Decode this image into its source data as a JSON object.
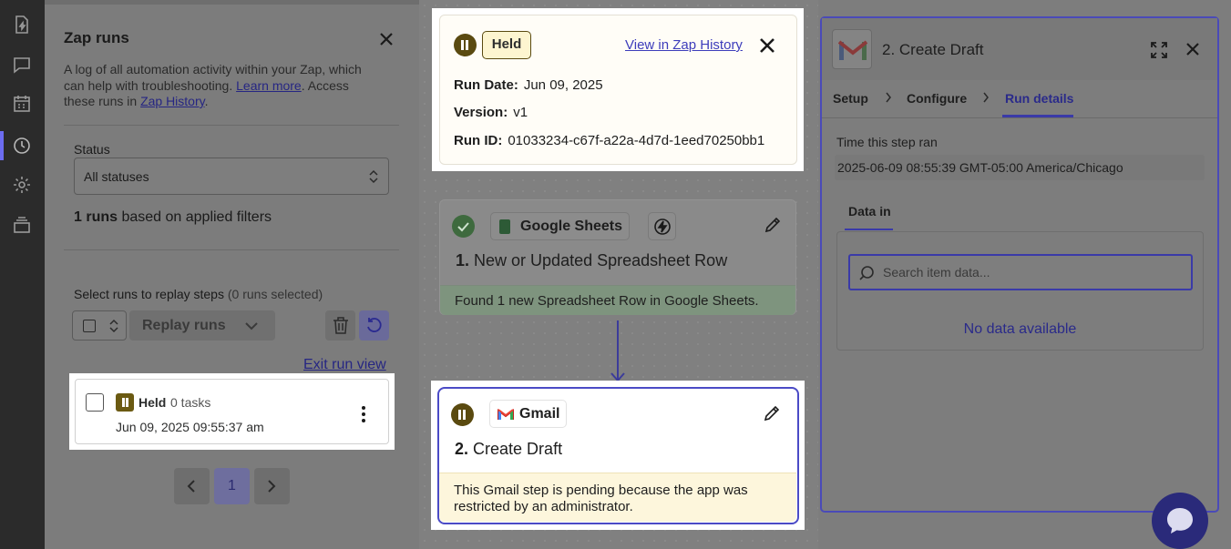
{
  "rail": {
    "icons": [
      "zap-file-icon",
      "comment-icon",
      "calendar-icon",
      "history-icon",
      "settings-icon",
      "versions-icon"
    ]
  },
  "runs_panel": {
    "title": "Zap runs",
    "description_prefix": "A log of all automation activity within your Zap, which can help with troubleshooting. ",
    "learn_more": "Learn more",
    "description_mid": ". Access these runs in ",
    "zap_history_link": "Zap History",
    "description_suffix": ".",
    "status_label": "Status",
    "status_value": "All statuses",
    "count_bold": "1 runs",
    "count_rest": " based on applied filters",
    "select_label": "Select runs to replay steps",
    "selected_count": "(0 runs selected)",
    "replay_label": "Replay runs",
    "exit_link": "Exit run view",
    "run": {
      "status": "Held",
      "tasks": "0 tasks",
      "date": "Jun 09, 2025 09:55:37 am"
    },
    "page": "1"
  },
  "info_card": {
    "badge": "Held",
    "history_link": "View in Zap History",
    "run_date_label": "Run Date:",
    "run_date": "Jun 09, 2025",
    "version_label": "Version:",
    "version": "v1",
    "run_id_label": "Run ID:",
    "run_id": "01033234-c67f-a22a-4d7d-1eed70250bb1"
  },
  "step1": {
    "app": "Google Sheets",
    "number": "1.",
    "title": "New or Updated Spreadsheet Row",
    "message": "Found 1 new Spreadsheet Row in Google Sheets."
  },
  "step2": {
    "app": "Gmail",
    "number": "2.",
    "title": "Create Draft",
    "message": "This Gmail step is pending because the app was restricted by an administrator."
  },
  "detail": {
    "title": "2. Create Draft",
    "tabs": [
      "Setup",
      "Configure",
      "Run details"
    ],
    "time_label": "Time this step ran",
    "time_value": "2025-06-09 08:55:39 GMT-05:00 America/Chicago",
    "data_tab": "Data in",
    "search_placeholder": "Search item data...",
    "no_data": "No data available"
  },
  "colors": {
    "accent": "#4b4bc6",
    "held": "#5a4a10",
    "success": "#3e6a3e"
  }
}
